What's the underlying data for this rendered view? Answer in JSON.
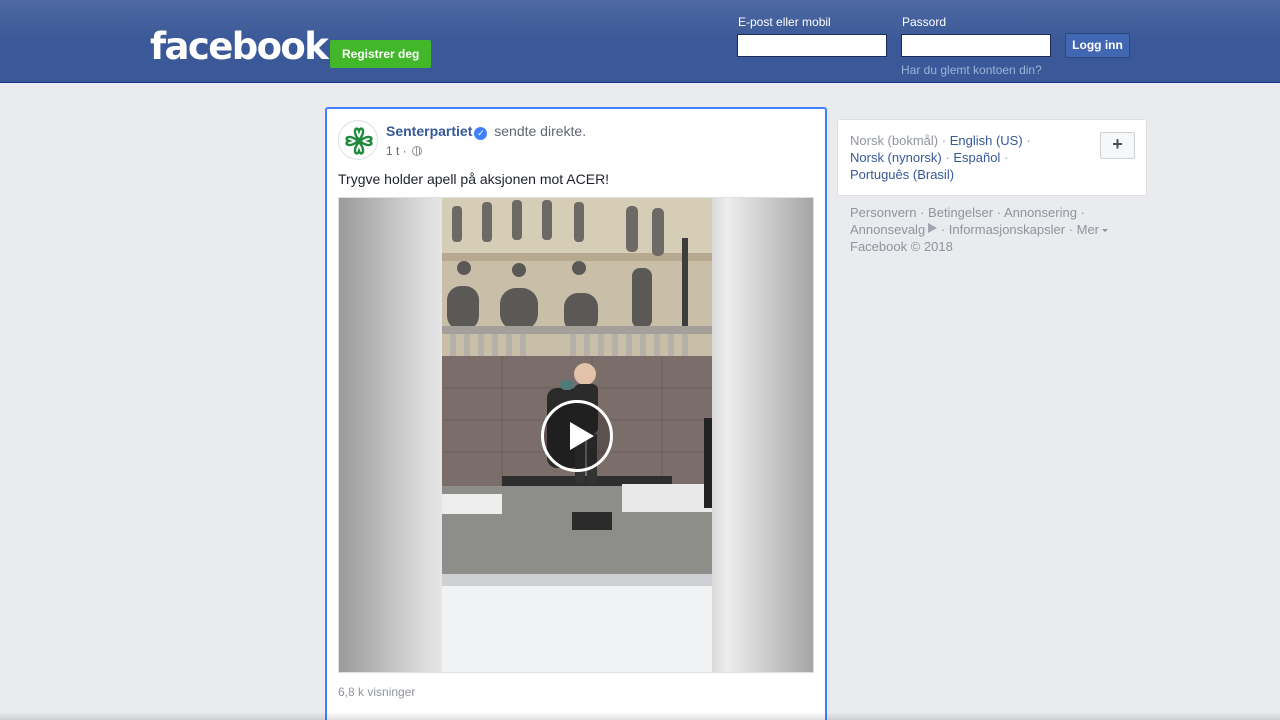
{
  "header": {
    "logo": "facebook",
    "signup_label": "Registrer deg",
    "email_label": "E-post eller mobil",
    "password_label": "Passord",
    "login_label": "Logg inn",
    "forgot_label": "Har du glemt kontoen din?"
  },
  "post": {
    "author": "Senterpartiet",
    "action": "sendte direkte.",
    "time": "1 t",
    "text": "Trygve holder apell på aksjonen mot ACER!",
    "views": "6,8 k visninger"
  },
  "languages": {
    "current": "Norsk (bokmål)",
    "links": [
      "English (US)",
      "Norsk (nynorsk)",
      "Español",
      "Português (Brasil)"
    ]
  },
  "footer": {
    "links": [
      "Personvern",
      "Betingelser",
      "Annonsering",
      "Annonsevalg",
      "Informasjonskapsler",
      "Mer"
    ],
    "copyright": "Facebook © 2018"
  },
  "colors": {
    "brand": "#3b5998",
    "signup": "#42b72a",
    "link": "#365899",
    "highlight_border": "#4080ff"
  }
}
